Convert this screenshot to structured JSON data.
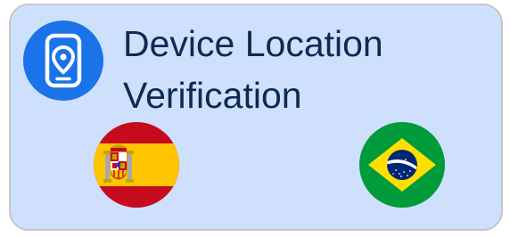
{
  "card": {
    "title": "Device Location Verification",
    "icon": "location-phone-icon",
    "accent_color": "#1a73e8",
    "background_color": "#cfe0fc"
  },
  "flags": [
    {
      "country": "Spain",
      "icon": "spain-flag-icon"
    },
    {
      "country": "Brazil",
      "icon": "brazil-flag-icon"
    }
  ]
}
